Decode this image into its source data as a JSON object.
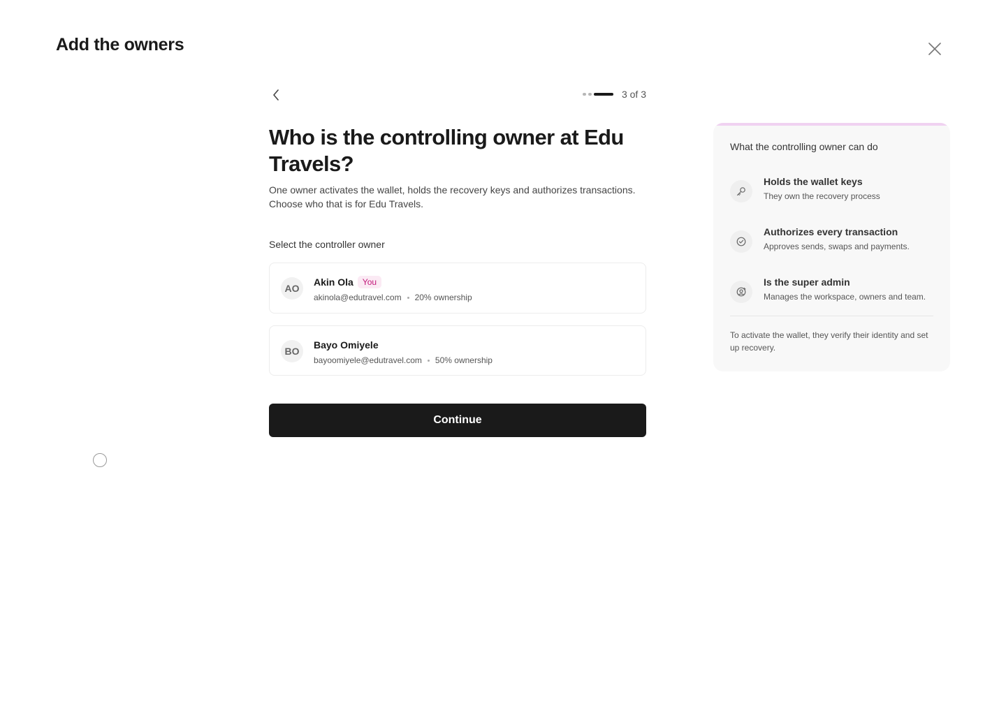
{
  "header": {
    "title": "Add the owners",
    "close_icon": "close-icon"
  },
  "nav": {
    "back_icon": "chevron-left-icon",
    "progress": {
      "current": 3,
      "total": 3,
      "text": "3 of 3"
    }
  },
  "main": {
    "question": "Who is the controlling owner at Edu Travels?",
    "description": "One owner activates the wallet, holds the recovery keys and authorizes transactions. Choose who that is for Edu Travels.",
    "select_label": "Select the controller owner",
    "owners": [
      {
        "initials": "AO",
        "name": "Akin Ola",
        "badge": "You",
        "email": "akinola@edutravel.com",
        "ownership": "20% ownership"
      },
      {
        "initials": "BO",
        "name": "Bayo Omiyele",
        "email": "bayoomiyele@edutravel.com",
        "ownership": "50% ownership"
      }
    ],
    "continue_label": "Continue"
  },
  "sidebar": {
    "title": "What the controlling owner can do",
    "items": [
      {
        "icon": "key-icon",
        "title": "Holds the wallet keys",
        "subtitle": "They own the recovery process"
      },
      {
        "icon": "check-circle-icon",
        "title": "Authorizes every transaction",
        "subtitle": "Approves sends, swaps and payments."
      },
      {
        "icon": "user-admin-icon",
        "title": "Is the super admin",
        "subtitle": "Manages the workspace, owners and team."
      }
    ],
    "note": "To activate the wallet, they verify their identity and set up recovery."
  },
  "colors": {
    "primary_button": "#1a1a1a",
    "badge_text": "#c2187a",
    "badge_bg": "#fbeaf4",
    "sidebar_accent": "#f0d2f1",
    "sidebar_bg": "#f8f8f8"
  }
}
